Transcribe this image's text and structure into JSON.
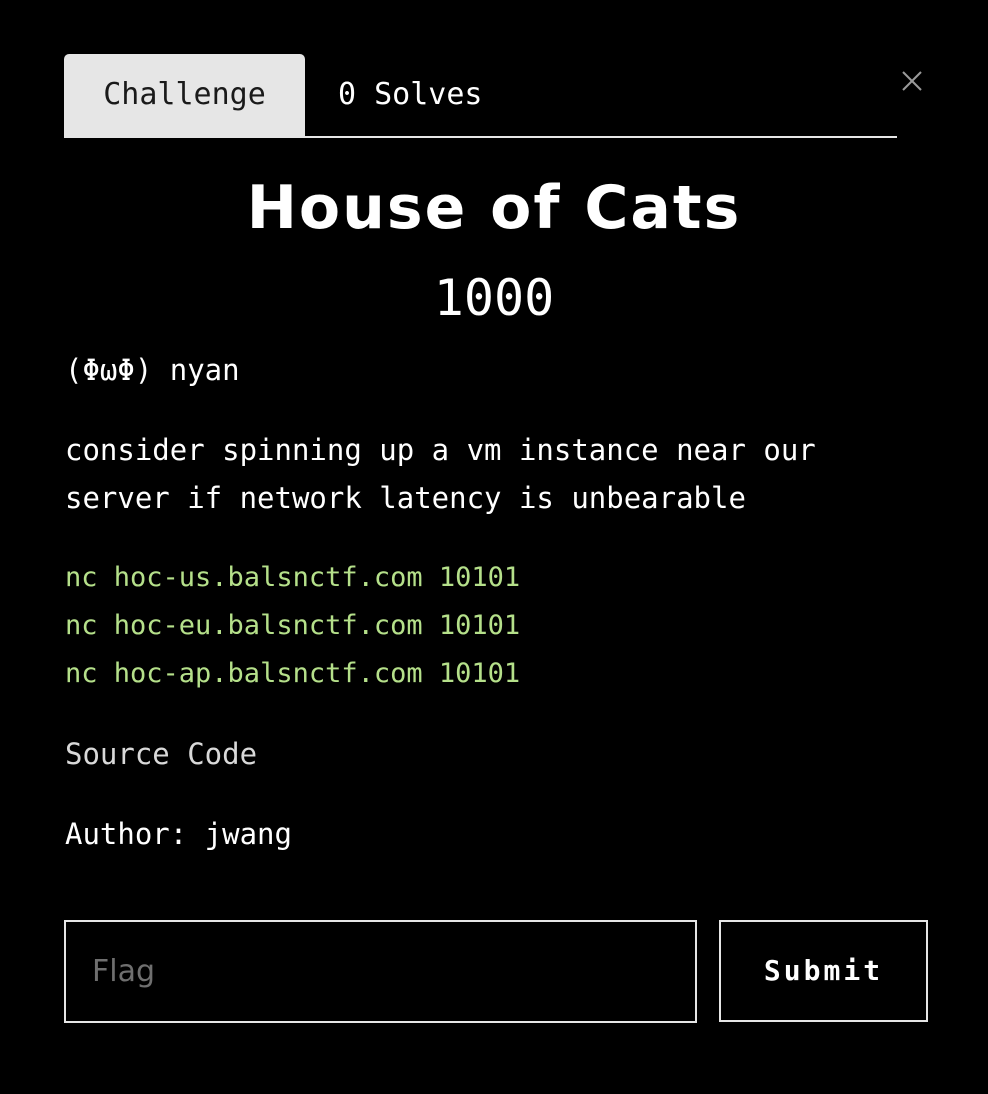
{
  "tabs": [
    {
      "label": "Challenge",
      "active": true
    },
    {
      "label": "0 Solves",
      "active": false
    }
  ],
  "close_icon": "close-icon",
  "challenge": {
    "title": "House of Cats",
    "points": "1000",
    "description": [
      "(ΦωΦ) nyan",
      "consider spinning up a vm instance near our server if network latency is unbearable"
    ],
    "commands": [
      "nc hoc-us.balsnctf.com 10101",
      "nc hoc-eu.balsnctf.com 10101",
      "nc hoc-ap.balsnctf.com 10101"
    ],
    "source_link": "Source Code",
    "author": "Author: jwang"
  },
  "form": {
    "flag_placeholder": "Flag",
    "flag_value": "",
    "submit_label": "Submit"
  },
  "colors": {
    "background": "#000000",
    "text": "#ffffff",
    "tab_active_bg": "#e6e6e6",
    "command_text": "#b5e08a",
    "border": "#e6e6e6"
  }
}
